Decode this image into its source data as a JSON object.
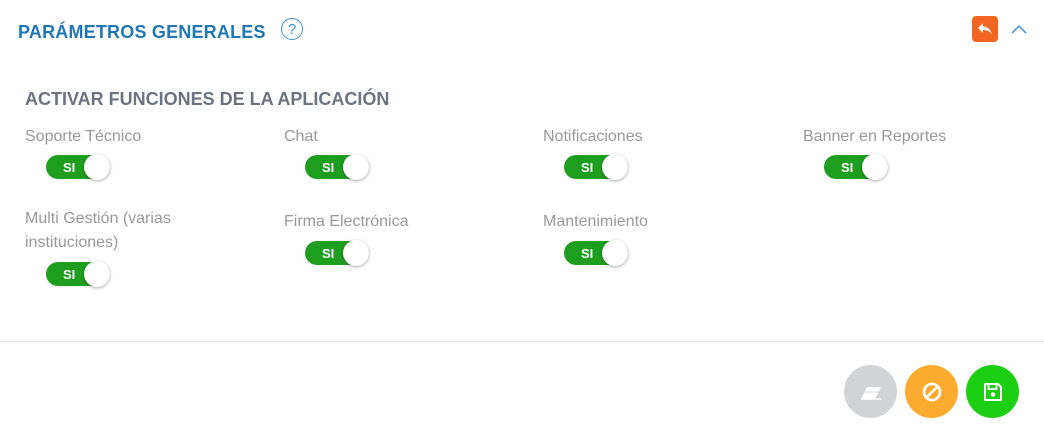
{
  "header": {
    "title": "PARÁMETROS GENERALES",
    "help_glyph": "?"
  },
  "section": {
    "title": "ACTIVAR FUNCIONES DE LA APLICACIÓN"
  },
  "features": [
    {
      "label": "Soporte Técnico",
      "state": "SI"
    },
    {
      "label": "Chat",
      "state": "SI"
    },
    {
      "label": "Notificaciones",
      "state": "SI"
    },
    {
      "label": "Banner en Reportes",
      "state": "SI"
    },
    {
      "label": "Multi Gestión (varias instituciones)",
      "state": "SI"
    },
    {
      "label": "Firma Electrónica",
      "state": "SI"
    },
    {
      "label": "Mantenimiento",
      "state": "SI"
    }
  ],
  "colors": {
    "title_blue": "#1f77b4",
    "toggle_on": "#1e9e1e",
    "back_orange": "#f26522",
    "clear_gray": "#d1d3d6",
    "cancel_orange": "#fdab2f",
    "save_green": "#1dcf12"
  },
  "icons": {
    "help": "question-circle-icon",
    "back": "reply-arrow-icon",
    "collapse": "chevron-up-icon",
    "clear": "eraser-icon",
    "cancel": "ban-icon",
    "save": "floppy-disk-icon"
  }
}
